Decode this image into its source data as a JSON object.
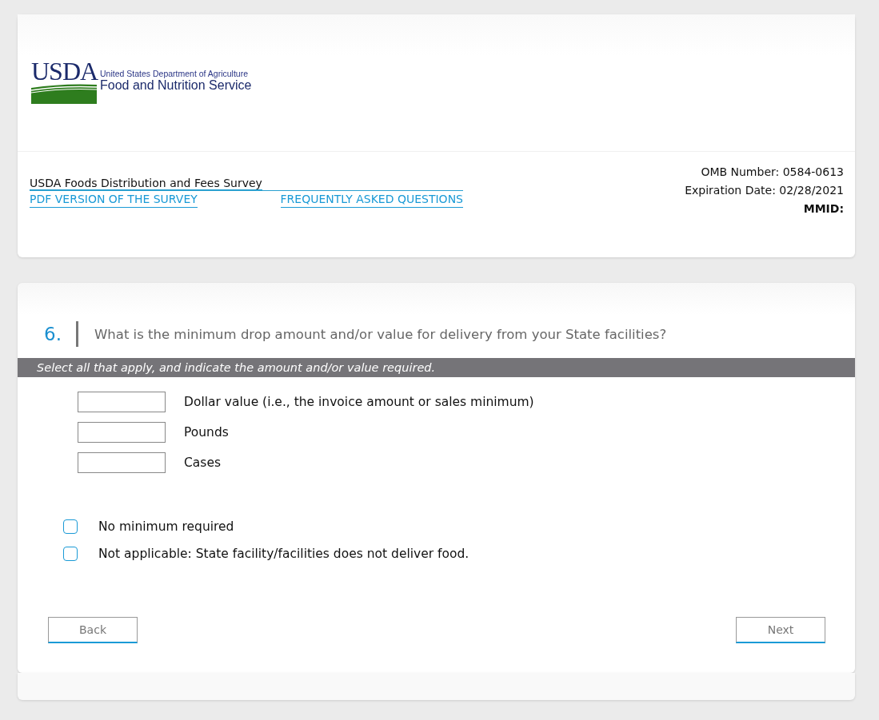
{
  "logo": {
    "acronym": "USDA",
    "department": "United States Department of Agriculture",
    "agency": "Food and Nutrition Service"
  },
  "survey": {
    "title": "USDA Foods Distribution and Fees Survey",
    "links": [
      "PDF VERSION OF THE SURVEY",
      "FREQUENTLY ASKED QUESTIONS"
    ]
  },
  "meta": {
    "omb": "OMB Number: 0584-0613",
    "expiration": "Expiration Date: 02/28/2021",
    "mmid": "MMID:"
  },
  "question": {
    "number": "6.",
    "text": "What is the minimum drop amount and/or value for delivery from your State facilities?",
    "instruction": "Select all that apply, and indicate the amount and/or value required.",
    "amounts": [
      {
        "label": "Dollar value (i.e., the invoice amount or sales minimum)"
      },
      {
        "label": "Pounds"
      },
      {
        "label": "Cases"
      }
    ],
    "options": [
      {
        "label": "No minimum required",
        "checked": false
      },
      {
        "label": "Not applicable: State facility/facilities does not deliver food.",
        "checked": false
      }
    ]
  },
  "buttons": [
    "Back",
    "Next"
  ]
}
